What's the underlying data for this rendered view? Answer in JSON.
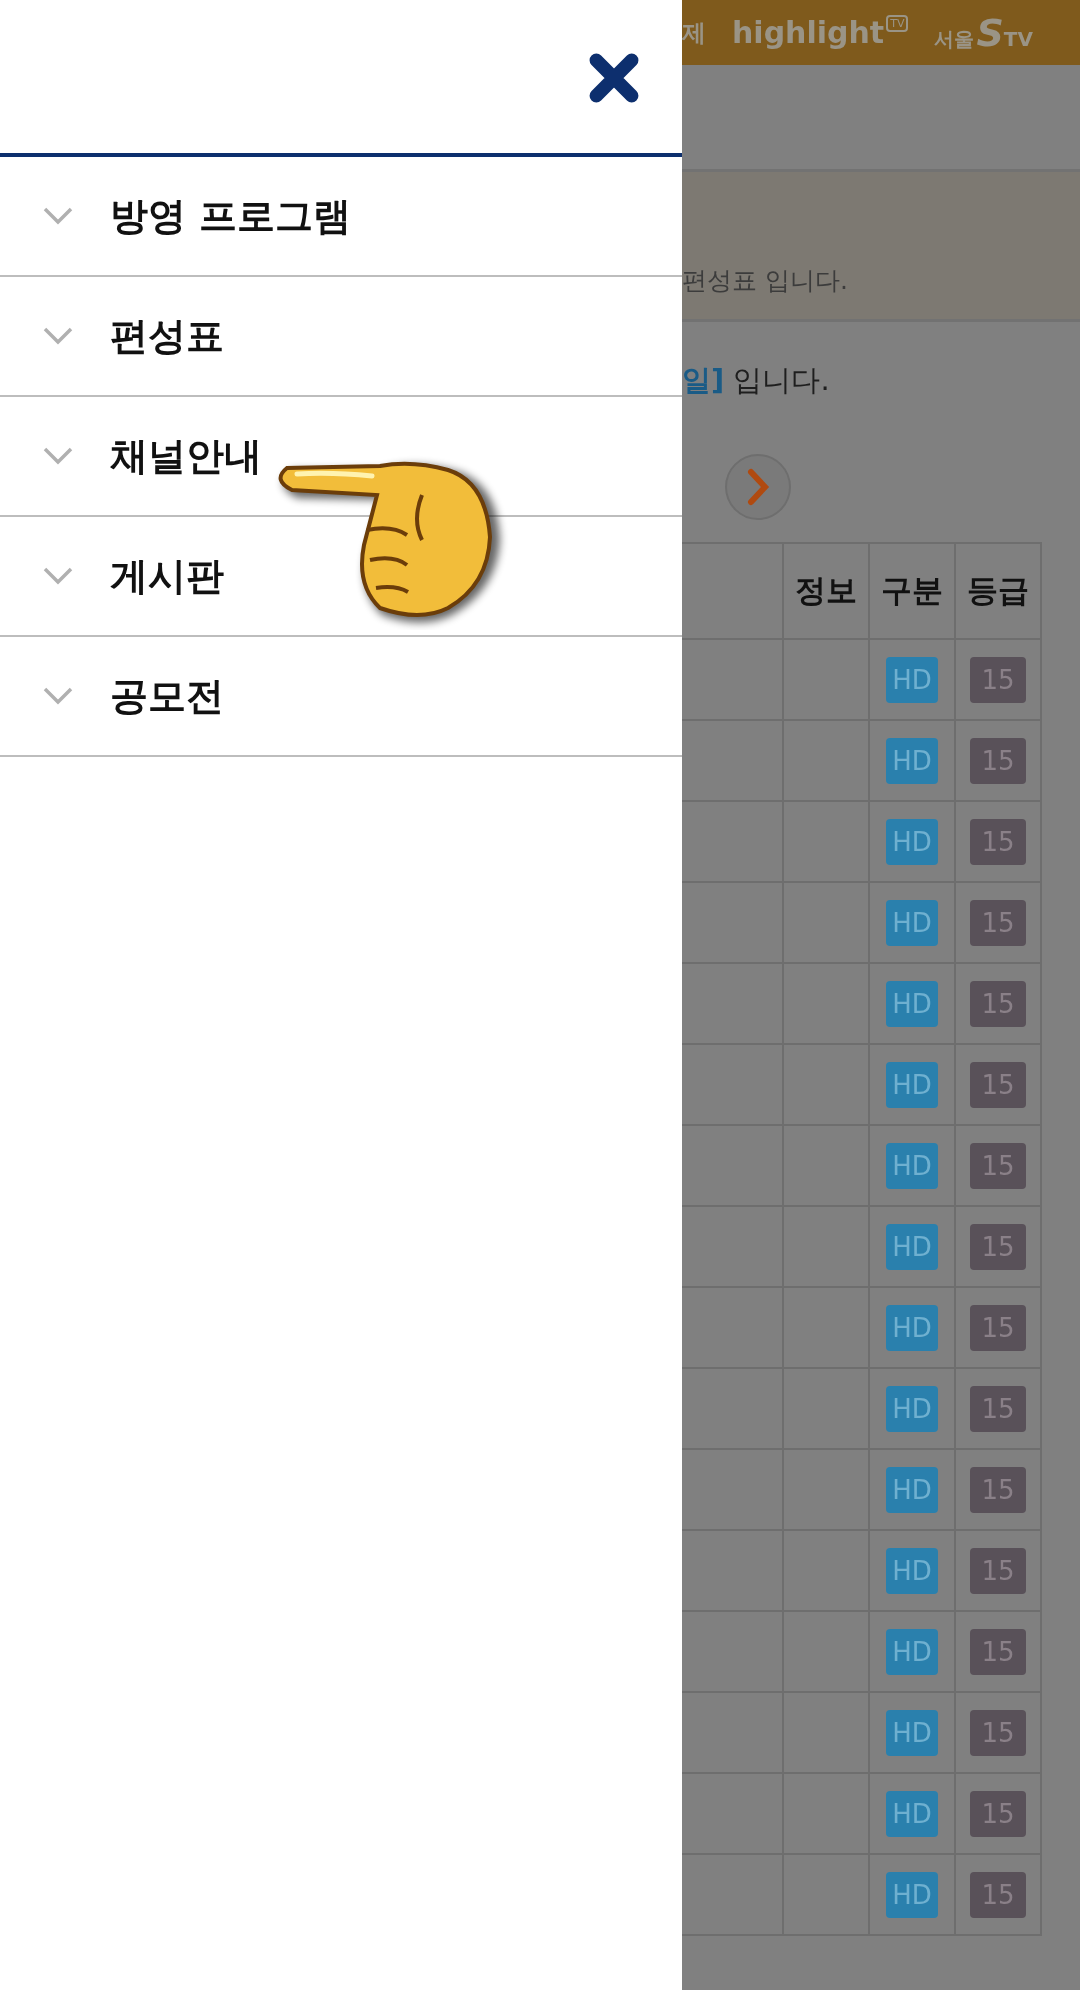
{
  "drawer": {
    "menu": [
      {
        "label": "방영 프로그램",
        "expanded": false
      },
      {
        "label": "편성표",
        "expanded": false
      },
      {
        "label": "채널안내",
        "expanded": false
      },
      {
        "label": "게시판",
        "expanded": false
      },
      {
        "label": "공모전",
        "expanded": false
      }
    ]
  },
  "page": {
    "header_logos": [
      {
        "kind": "plain",
        "text": "제"
      },
      {
        "kind": "highlight",
        "text": "highlight",
        "badge": "TV"
      },
      {
        "kind": "seoul",
        "text": "서울",
        "mark": "S",
        "suffix": "TV"
      }
    ],
    "notice": "편성표 입니다.",
    "date_line": {
      "date": "일]",
      "rest": "입니다."
    },
    "table": {
      "columns": [
        "정보",
        "구분",
        "등급"
      ],
      "rows": [
        {
          "type": "HD",
          "grade": "15"
        },
        {
          "type": "HD",
          "grade": "15"
        },
        {
          "type": "HD",
          "grade": "15"
        },
        {
          "type": "HD",
          "grade": "15"
        },
        {
          "type": "HD",
          "grade": "15"
        },
        {
          "type": "HD",
          "grade": "15"
        },
        {
          "type": "HD",
          "grade": "15"
        },
        {
          "type": "HD",
          "grade": "15"
        },
        {
          "type": "HD",
          "grade": "15"
        },
        {
          "type": "HD",
          "grade": "15"
        },
        {
          "type": "HD",
          "grade": "15"
        },
        {
          "type": "HD",
          "grade": "15"
        },
        {
          "type": "HD",
          "grade": "15"
        },
        {
          "type": "HD",
          "grade": "15"
        },
        {
          "type": "HD",
          "grade": "15"
        },
        {
          "type": "HD",
          "grade": "15"
        }
      ]
    }
  }
}
